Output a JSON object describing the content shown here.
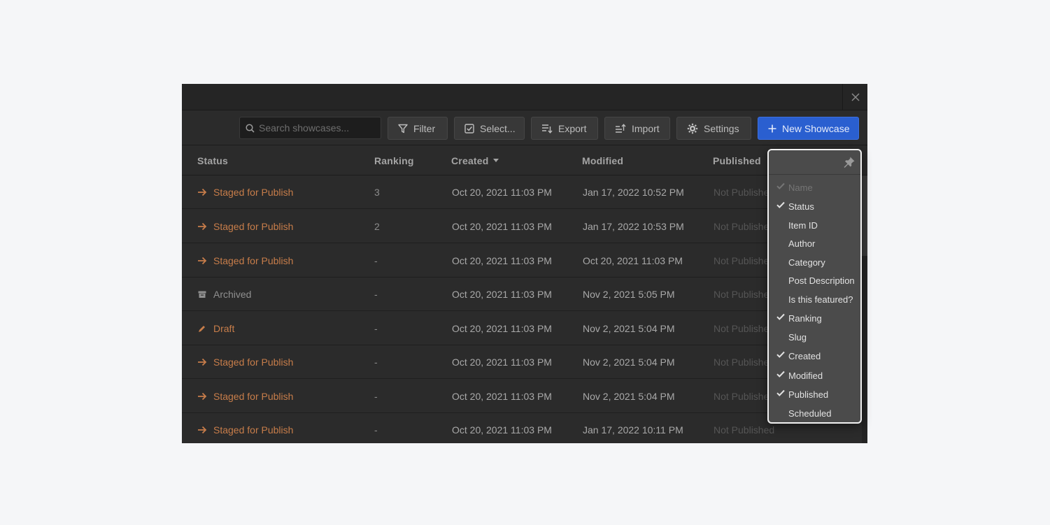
{
  "toolbar": {
    "search_placeholder": "Search showcases...",
    "filter": "Filter",
    "select": "Select...",
    "export": "Export",
    "import": "Import",
    "settings": "Settings",
    "new_showcase": "New Showcase"
  },
  "columns": {
    "status": "Status",
    "ranking": "Ranking",
    "created": "Created",
    "modified": "Modified",
    "published": "Published"
  },
  "rows": [
    {
      "status": "Staged for Publish",
      "ranking": "3",
      "created": "Oct 20, 2021 11:03 PM",
      "modified": "Jan 17, 2022 10:52 PM",
      "published": "Not Published"
    },
    {
      "status": "Staged for Publish",
      "ranking": "2",
      "created": "Oct 20, 2021 11:03 PM",
      "modified": "Jan 17, 2022 10:53 PM",
      "published": "Not Published"
    },
    {
      "status": "Staged for Publish",
      "ranking": "-",
      "created": "Oct 20, 2021 11:03 PM",
      "modified": "Oct 20, 2021 11:03 PM",
      "published": "Not Published"
    },
    {
      "status": "Archived",
      "ranking": "-",
      "created": "Oct 20, 2021 11:03 PM",
      "modified": "Nov 2, 2021 5:05 PM",
      "published": "Not Published"
    },
    {
      "status": "Draft",
      "ranking": "-",
      "created": "Oct 20, 2021 11:03 PM",
      "modified": "Nov 2, 2021 5:04 PM",
      "published": "Not Published"
    },
    {
      "status": "Staged for Publish",
      "ranking": "-",
      "created": "Oct 20, 2021 11:03 PM",
      "modified": "Nov 2, 2021 5:04 PM",
      "published": "Not Published"
    },
    {
      "status": "Staged for Publish",
      "ranking": "-",
      "created": "Oct 20, 2021 11:03 PM",
      "modified": "Nov 2, 2021 5:04 PM",
      "published": "Not Published"
    },
    {
      "status": "Staged for Publish",
      "ranking": "-",
      "created": "Oct 20, 2021 11:03 PM",
      "modified": "Jan 17, 2022 10:11 PM",
      "published": "Not Published"
    }
  ],
  "column_menu": {
    "items": [
      {
        "label": "Name",
        "checked": true,
        "disabled": true
      },
      {
        "label": "Status",
        "checked": true
      },
      {
        "label": "Item ID",
        "checked": false
      },
      {
        "label": "Author",
        "checked": false
      },
      {
        "label": "Category",
        "checked": false
      },
      {
        "label": "Post Description",
        "checked": false
      },
      {
        "label": "Is this featured?",
        "checked": false
      },
      {
        "label": "Ranking",
        "checked": true
      },
      {
        "label": "Slug",
        "checked": false
      },
      {
        "label": "Created",
        "checked": true
      },
      {
        "label": "Modified",
        "checked": true
      },
      {
        "label": "Published",
        "checked": true
      },
      {
        "label": "Scheduled",
        "checked": false
      }
    ]
  },
  "colors": {
    "staged": "#c77d4a",
    "archived": "#8f8f8f",
    "primary": "#2a5fd0"
  },
  "icons": {
    "staged": "arrow-right-icon",
    "archived": "archive-box-icon",
    "draft": "pencil-icon"
  }
}
